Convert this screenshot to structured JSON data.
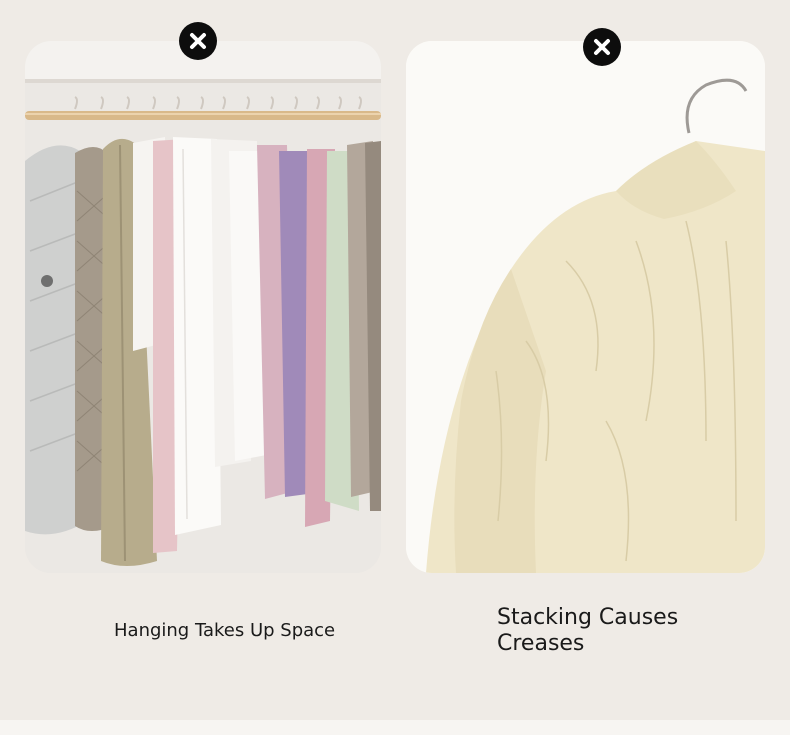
{
  "panels": [
    {
      "caption": "Hanging Takes Up Space",
      "badge_icon": "close-icon"
    },
    {
      "caption": "Stacking Causes Creases",
      "badge_icon": "close-icon"
    }
  ],
  "colors": {
    "background": "#efebe6",
    "badge": "#0d0d0d",
    "rod": "#d9b98a",
    "shirt": "#efe6c8"
  }
}
